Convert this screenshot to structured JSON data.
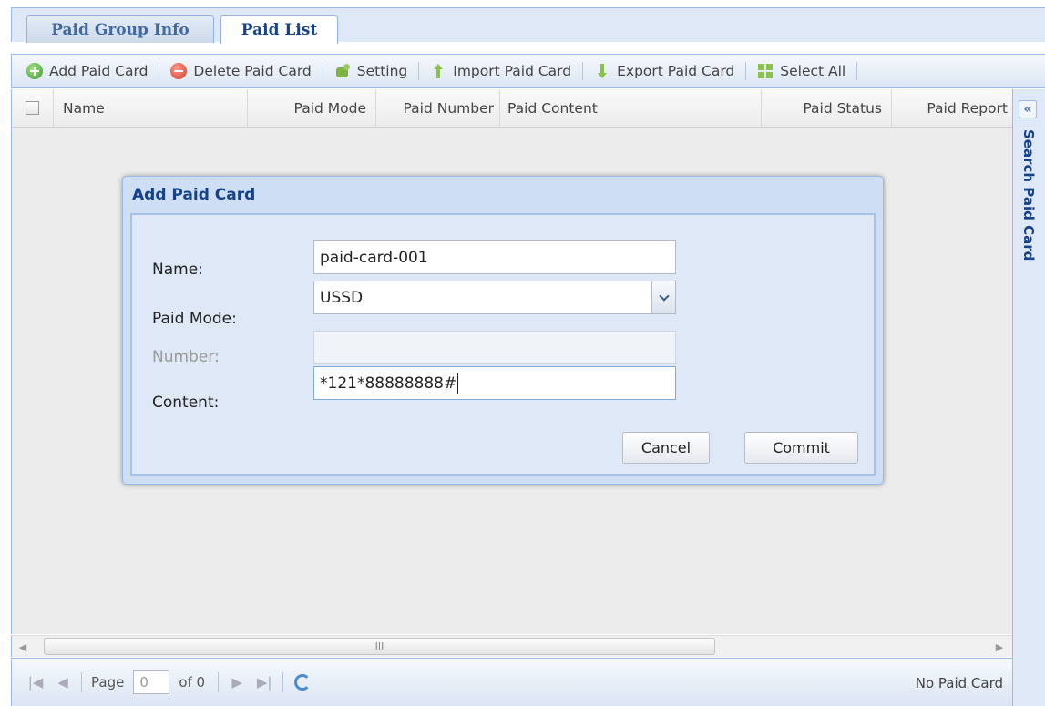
{
  "tabs": [
    {
      "label": "Paid Group Info"
    },
    {
      "label": "Paid List"
    }
  ],
  "toolbar": {
    "add": "Add Paid Card",
    "delete": "Delete Paid Card",
    "setting": "Setting",
    "import": "Import Paid Card",
    "export": "Export Paid Card",
    "select_all": "Select All"
  },
  "grid": {
    "columns": [
      "Name",
      "Paid Mode",
      "Paid Number",
      "Paid Content",
      "Paid Status",
      "Paid Report"
    ],
    "scroll_grip": "III"
  },
  "side_panel": {
    "collapse_glyph": "«",
    "title": "Search Paid Card"
  },
  "pager": {
    "page_label": "Page",
    "page_value": "0",
    "of_label": "of 0",
    "status": "No Paid Card"
  },
  "dialog": {
    "title": "Add Paid Card",
    "fields": {
      "name": {
        "label": "Name:",
        "value": "paid-card-001"
      },
      "mode": {
        "label": "Paid Mode:",
        "value": "USSD"
      },
      "number": {
        "label": "Number:",
        "value": ""
      },
      "content": {
        "label": "Content:",
        "value": "*121*88888888#"
      }
    },
    "cancel": "Cancel",
    "commit": "Commit"
  }
}
